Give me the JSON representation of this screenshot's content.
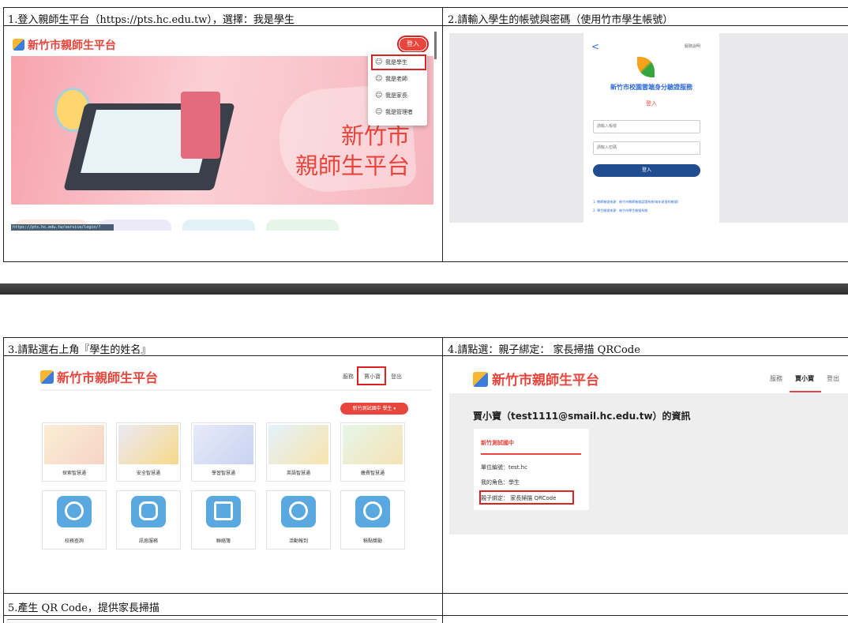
{
  "captions": {
    "c1": "1.登入親師生平台（https://pts.hc.edu.tw），選擇：我是學生",
    "c2": "2.請輸入學生的帳號與密碼（使用竹市學生帳號）",
    "c3": "3.請點選右上角『學生的姓名』",
    "c4": "4.請點選：親子綁定： 家長掃描 QRCode",
    "c5": "5.產生 QR Code，提供家長掃描"
  },
  "shot1": {
    "logo": "新竹市親師生平台",
    "login": "登入",
    "hero_line1": "新竹市",
    "hero_line2": "親師生平台",
    "menu": [
      "我是學生",
      "我是老師",
      "我是家長",
      "我是管理者"
    ],
    "status_url": "https://pts.hc.edu.tw/service/login/?redirect=/profile"
  },
  "shot2": {
    "back": "<",
    "help": "服務說明",
    "title": "新竹市校園雲端身分驗證服務",
    "subtitle": "登入",
    "account_placeholder": "請輸入帳號",
    "password_placeholder": "請輸入密碼",
    "button": "登入",
    "note1": "1. 教師帳號來源：新竹市教師帳號認證系統(每年研習的帳號)",
    "note2": "2. 學生帳號來源：新竹市學生帳號系統"
  },
  "shot3": {
    "logo": "新竹市親師生平台",
    "nav_service": "服務",
    "nav_name": "賈小寶",
    "nav_logout": "登出",
    "pill": "新竹測試國中 學生 ▾",
    "tiles_row1": [
      "探索智慧通",
      "安全智慧通",
      "學習智慧通",
      "英語智慧通",
      "繳費智慧通"
    ],
    "tiles_row2": [
      "校務查詢",
      "訊息服務",
      "聯絡簿",
      "活動報到",
      "積點獎勵"
    ]
  },
  "shot4": {
    "logo": "新竹市親師生平台",
    "nav_service": "服務",
    "nav_name": "賈小寶",
    "nav_logout": "登出",
    "heading": "賈小寶（test1111@smail.hc.edu.tw）的資訊",
    "school": "新竹測試國中",
    "unit_code": "單位編號：test.hc",
    "role": "我的角色：學生",
    "bind": "親子綁定： 家長掃描 QRCode"
  },
  "colors": {
    "brand": "#e8453c",
    "highlight": "#dd2222",
    "login_blue": "#1f4d8f"
  }
}
